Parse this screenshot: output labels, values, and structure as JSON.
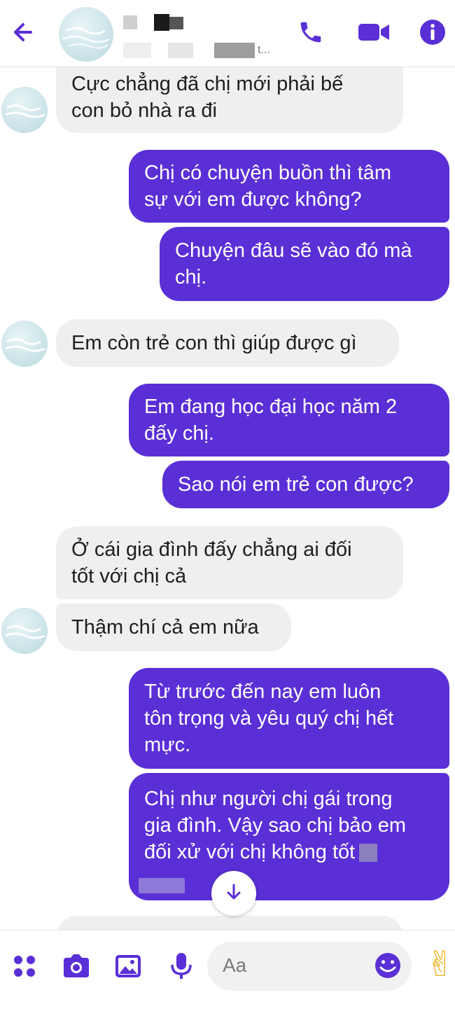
{
  "header": {
    "status_suffix": "t...",
    "icons": {
      "back": "back-arrow-icon",
      "phone": "phone-icon",
      "video": "video-camera-icon",
      "info": "info-icon"
    },
    "accent": "#5a2fd6"
  },
  "messages": [
    {
      "side": "in",
      "text_lines": [
        "Cực chẳng đã chị mới phải bế",
        "con bỏ nhà ra đi"
      ]
    },
    {
      "side": "out",
      "text_lines": [
        "Chị có chuyện buồn thì tâm",
        "sự với em được không?"
      ]
    },
    {
      "side": "out",
      "text_lines": [
        "Chuyện đâu sẽ vào đó mà",
        "chị."
      ]
    },
    {
      "side": "in",
      "text_lines": [
        "Em còn trẻ con thì giúp được gì"
      ]
    },
    {
      "side": "out",
      "text_lines": [
        "Em đang học đại học năm 2",
        "đấy chị."
      ]
    },
    {
      "side": "out",
      "text_lines": [
        "Sao nói em trẻ con được?"
      ]
    },
    {
      "side": "in",
      "text_lines": [
        "Ở cái gia đình đấy chẳng ai đối",
        "tốt với chị cả"
      ]
    },
    {
      "side": "in",
      "text_lines": [
        "Thậm chí cả em nữa"
      ]
    },
    {
      "side": "out",
      "text_lines": [
        "Từ trước đến nay em luôn",
        "tôn trọng và yêu quý chị hết",
        "mực."
      ]
    },
    {
      "side": "out",
      "text_lines": [
        "Chị như người chị gái trong",
        "gia đình. Vậy sao chị bảo em",
        "đối xử với chị không tốt"
      ]
    }
  ],
  "composer": {
    "placeholder": "Aa",
    "icons": [
      "apps-dots-icon",
      "camera-icon",
      "image-icon",
      "microphone-icon",
      "emoji-icon",
      "hand-gesture-icon"
    ],
    "hand_glyph": "✌"
  },
  "colors": {
    "outgoing": "#5a2fd6",
    "incoming": "#efefef"
  }
}
